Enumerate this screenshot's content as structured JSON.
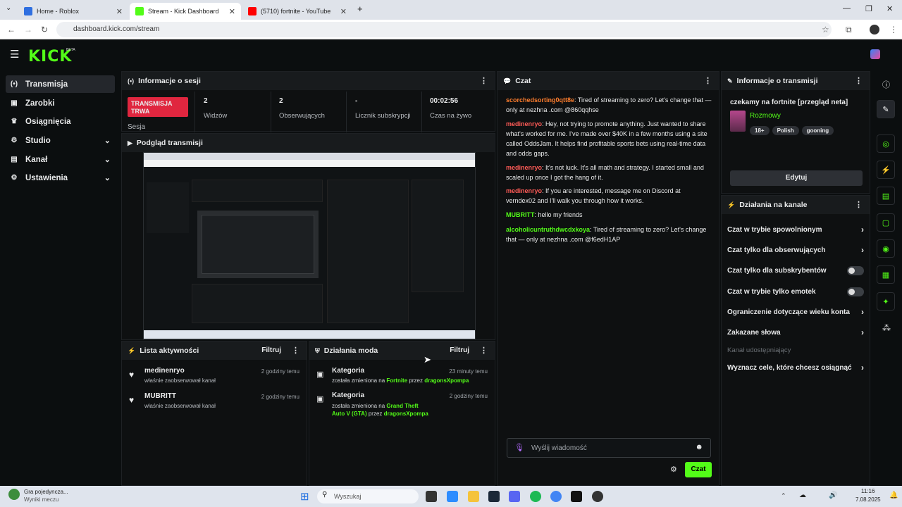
{
  "browser": {
    "tabs": [
      {
        "title": "Home - Roblox",
        "color": "#2f6fe0"
      },
      {
        "title": "Stream - Kick Dashboard",
        "color": "#53fc18"
      },
      {
        "title": "(5710) fortnite - YouTube",
        "color": "#ff0000"
      }
    ],
    "new_tab": "+",
    "url": "dashboard.kick.com/stream"
  },
  "kick": {
    "logo": "KICK",
    "beta": "BETA"
  },
  "sidebar": {
    "items": [
      {
        "label": "Transmisja",
        "icon": "broadcast-icon",
        "glyph": "(•)"
      },
      {
        "label": "Zarobki",
        "icon": "earnings-icon",
        "glyph": "▣"
      },
      {
        "label": "Osiągnięcia",
        "icon": "trophy-icon",
        "glyph": "🏆"
      },
      {
        "label": "Studio",
        "icon": "studio-icon",
        "glyph": "⚙"
      },
      {
        "label": "Kanał",
        "icon": "channel-icon",
        "glyph": "◆"
      },
      {
        "label": "Ustawienia",
        "icon": "settings-icon",
        "glyph": "⚙"
      }
    ]
  },
  "session": {
    "title": "Informacje o sesji",
    "badge": "TRANSMISJA TRWA",
    "badge_sub": "Sesja",
    "stats": [
      {
        "value": "2",
        "label": "Widzów"
      },
      {
        "value": "2",
        "label": "Obserwujących"
      },
      {
        "value": "-",
        "label": "Licznik subskrypcji"
      },
      {
        "value": "00:02:56",
        "label": "Czas na żywo"
      }
    ]
  },
  "preview": {
    "title": "Podgląd transmisji"
  },
  "activity": {
    "title": "Lista aktywności",
    "filter": "Filtruj",
    "items": [
      {
        "name": "medinenryo",
        "text": "właśnie zaobserwował kanał",
        "time": "2 godziny temu"
      },
      {
        "name": "MUBRITT",
        "text": "właśnie zaobserwował kanał",
        "time": "2 godziny temu"
      }
    ]
  },
  "mod": {
    "title": "Działania moda",
    "filter": "Filtruj",
    "items": [
      {
        "name": "Kategoria",
        "prefix": "została zmieniona na",
        "game": "Fortnite",
        "by": "przez",
        "user": "dragonsXpompa",
        "time": "23 minuty temu"
      },
      {
        "name": "Kategoria",
        "prefix": "została zmieniona na",
        "game": "Grand Theft Auto V (GTA)",
        "by": "przez",
        "user": "dragonsXpompa",
        "time": "2 godziny temu"
      }
    ]
  },
  "chat": {
    "title": "Czat",
    "messages": [
      {
        "user": "scorchedsorting0qtt8e",
        "text": ": Tired of streaming to zero? Let's change that — only at nezhna .com @860qqhse"
      },
      {
        "user": "medinenryo",
        "text": ": Hey, not trying to promote anything. Just wanted to share what's worked for me. I've made over $40K in a few months using a site called OddsJam. It helps find profitable sports bets using real-time data and odds gaps."
      },
      {
        "user": "medinenryo",
        "text": ": It's not luck. It's all math and strategy. I started small and scaled up once I got the hang of it."
      },
      {
        "user": "medinenryo",
        "text": ": If you are interested, message me on Discord at verndex02 and I'll walk you through how it works."
      },
      {
        "user": "MUBRITT",
        "text": ": hello my friends"
      },
      {
        "user": "alcoholicuntruthdwcdxkoya",
        "text": ": Tired of streaming to zero? Let's change that — only at nezhna .com @f6edH1AP"
      }
    ],
    "placeholder": "Wyślij wiadomość",
    "send": "Czat"
  },
  "stream_info": {
    "title": "Informacje o transmisji",
    "stream_title": "czekamy na fortnite [przegląd neta]",
    "category": "Rozmowy",
    "tags": [
      "18+",
      "Polish",
      "gooning"
    ],
    "edit": "Edytuj"
  },
  "channel_actions": {
    "title": "Działania na kanale",
    "items": [
      {
        "label": "Czat w trybie spowolnionym",
        "control": "chevron"
      },
      {
        "label": "Czat tylko dla obserwujących",
        "control": "chevron"
      },
      {
        "label": "Czat tylko dla subskrybentów",
        "control": "toggle"
      },
      {
        "label": "Czat w trybie tylko emotek",
        "control": "toggle"
      },
      {
        "label": "Ograniczenie dotyczące wieku konta",
        "control": "chevron"
      },
      {
        "label": "Zakazane słowa",
        "control": "chevron"
      }
    ],
    "disabled_label": "Kanał udostępniający",
    "goals": "Wyznacz cele, które chcesz osiągnąć"
  },
  "taskbar": {
    "notif_title": "Gra pojedyncza...",
    "notif_sub": "Wyniki meczu",
    "search": "Wyszukaj",
    "time": "11:16",
    "date": "7.08.2025"
  }
}
